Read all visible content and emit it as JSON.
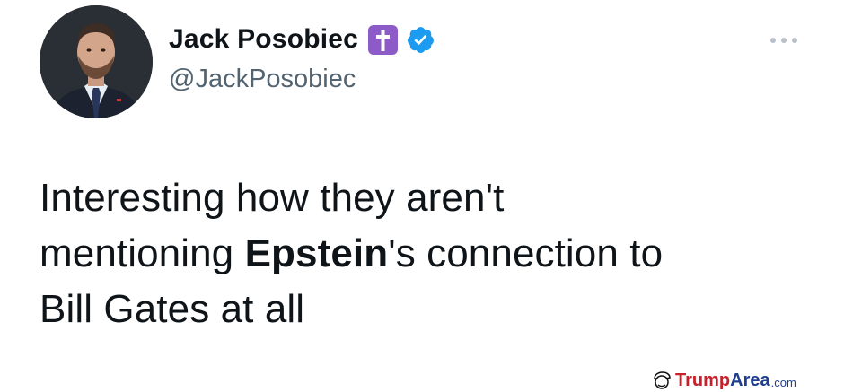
{
  "author": {
    "display_name": "Jack Posobiec",
    "handle": "@JackPosobiec"
  },
  "icons": {
    "cross_emoji": "latin-cross-emoji",
    "verified": "verified-badge-icon",
    "more": "more-options-icon",
    "avatar": "profile-photo"
  },
  "tweet": {
    "line1": "Interesting how they aren't",
    "line2_pre": "mentioning ",
    "line2_bold": "Epstein",
    "line2_post": "'s connection to",
    "line3": "Bill Gates at all"
  },
  "watermark": {
    "trump": "Trump",
    "area": "Area",
    "com": ".com"
  },
  "colors": {
    "verified_blue": "#1d9bf0",
    "cross_purple": "#8c5bc7",
    "text": "#0f1419",
    "handle_gray": "#536471",
    "watermark_red": "#c8202a",
    "watermark_blue": "#1f3f8f"
  }
}
